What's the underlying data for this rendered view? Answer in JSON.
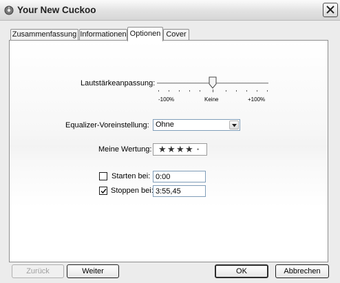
{
  "window": {
    "title": "Your New Cuckoo",
    "app_icon": "cuckoo-app-icon",
    "close_icon": "close-x-icon"
  },
  "tabs": [
    {
      "label": "Zusammenfassung",
      "active": false
    },
    {
      "label": "Informationen",
      "active": false
    },
    {
      "label": "Optionen",
      "active": true
    },
    {
      "label": "Cover",
      "active": false
    }
  ],
  "options": {
    "volume": {
      "label": "Lautstärkeanpassung:",
      "tick_left": "-100%",
      "tick_mid": "Keine",
      "tick_right": "+100%",
      "value_percent": 0
    },
    "equalizer": {
      "label": "Equalizer-Voreinstellung:",
      "value": "Ohne"
    },
    "rating": {
      "label": "Meine Wertung:",
      "stars": 4,
      "max": 5
    },
    "start": {
      "label": "Starten bei:",
      "checked": false,
      "value": "0:00"
    },
    "stop": {
      "label": "Stoppen bei:",
      "checked": true,
      "value": "3:55,45"
    }
  },
  "buttons": {
    "back": "Zurück",
    "next": "Weiter",
    "ok": "OK",
    "cancel": "Abbrechen"
  }
}
